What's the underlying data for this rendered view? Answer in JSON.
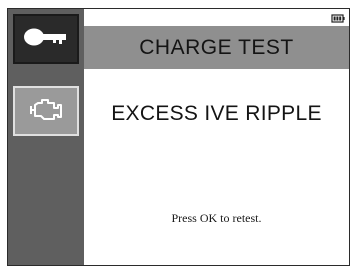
{
  "screen": {
    "header_title": "CHARGE TEST",
    "message": "EXCESS IVE RIPPLE",
    "hint": "Press OK to retest."
  },
  "sidebar": {
    "items": [
      {
        "icon": "key-icon",
        "state": "selected"
      },
      {
        "icon": "engine-icon",
        "state": "normal"
      }
    ]
  },
  "status": {
    "battery_icon": "battery-icon"
  },
  "colors": {
    "sidebar_bg": "#5f5f5f",
    "header_bg": "#8f8f8f",
    "selected_button_bg": "#2a2a2a",
    "normal_button_bg": "#9a9a9a"
  }
}
